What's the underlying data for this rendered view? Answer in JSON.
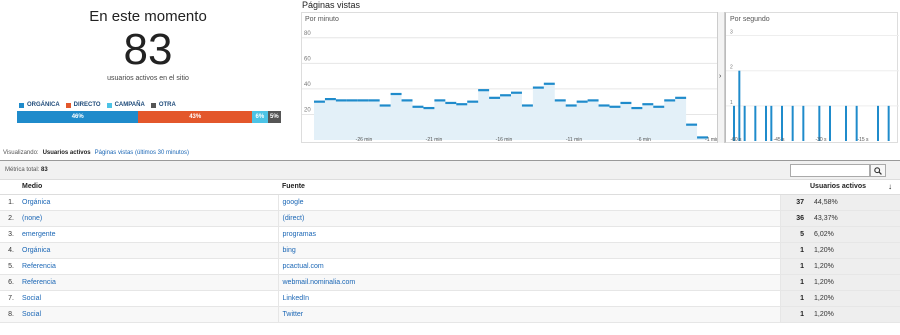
{
  "realtime": {
    "title": "En este momento",
    "count": "83",
    "caption": "usuarios activos en el sitio"
  },
  "traffic_legend": [
    {
      "label": "ORGÁNICA",
      "color": "#1f8bcb"
    },
    {
      "label": "DIRECTO",
      "color": "#e3572b"
    },
    {
      "label": "CAMPAÑA",
      "color": "#4cc3e6"
    },
    {
      "label": "OTRA",
      "color": "#555555"
    }
  ],
  "traffic_split": [
    {
      "label": "46%",
      "value": 46,
      "color": "#1f8bcb"
    },
    {
      "label": "43%",
      "value": 43,
      "color": "#e3572b"
    },
    {
      "label": "6%",
      "value": 6,
      "color": "#4cc3e6"
    },
    {
      "label": "5%",
      "value": 5,
      "color": "#555555"
    }
  ],
  "pageviews": {
    "title": "Páginas vistas",
    "per_minute_label": "Por minuto",
    "per_second_label": "Por segundo",
    "split_arrow": "›"
  },
  "chart_data": [
    {
      "type": "bar",
      "title": "Por minuto",
      "yticks": [
        20,
        40,
        60,
        80
      ],
      "ylim": [
        0,
        90
      ],
      "xticks": [
        "-26 min",
        "-21 min",
        "-16 min",
        "-11 min",
        "-6 min",
        "-1 min"
      ],
      "values": [
        30,
        32,
        31,
        31,
        31,
        31,
        27,
        36,
        31,
        26,
        25,
        31,
        29,
        28,
        30,
        39,
        33,
        35,
        37,
        27,
        41,
        44,
        31,
        27,
        30,
        31,
        27,
        26,
        29,
        25,
        28,
        26,
        31,
        33,
        12,
        2
      ],
      "grid": true
    },
    {
      "type": "bar",
      "title": "Por segundo",
      "yticks": [
        1,
        2,
        3
      ],
      "ylim": [
        0,
        3.3
      ],
      "xticks": [
        "-60 s",
        "-45 s",
        "-30 s",
        "-15 s"
      ],
      "values": [
        1,
        2,
        1,
        0,
        1,
        0,
        1,
        1,
        0,
        1,
        0,
        1,
        0,
        1,
        0,
        0,
        1,
        0,
        1,
        0,
        0,
        1,
        0,
        1,
        0,
        0,
        0,
        1,
        0,
        1
      ],
      "grid": true
    }
  ],
  "viewing": {
    "label": "Visualizando:",
    "active": "Usuarios activos",
    "pages": "Páginas vistas (últimos 30 minutos)"
  },
  "metric": {
    "label": "Métrica total:",
    "value": "83"
  },
  "search": {
    "placeholder": ""
  },
  "table": {
    "columns": {
      "medio": "Medio",
      "fuente": "Fuente",
      "usuarios": "Usuarios activos",
      "sort": "↓"
    },
    "rows": [
      {
        "idx": "1.",
        "medio": "Orgánica",
        "fuente": "google",
        "val": "37",
        "pct": "44,58%"
      },
      {
        "idx": "2.",
        "medio": "(none)",
        "fuente": "(direct)",
        "val": "36",
        "pct": "43,37%"
      },
      {
        "idx": "3.",
        "medio": "emergente",
        "fuente": "programas",
        "val": "5",
        "pct": "6,02%"
      },
      {
        "idx": "4.",
        "medio": "Orgánica",
        "fuente": "bing",
        "val": "1",
        "pct": "1,20%"
      },
      {
        "idx": "5.",
        "medio": "Referencia",
        "fuente": "pcactual.com",
        "val": "1",
        "pct": "1,20%"
      },
      {
        "idx": "6.",
        "medio": "Referencia",
        "fuente": "webmail.nominalia.com",
        "val": "1",
        "pct": "1,20%"
      },
      {
        "idx": "7.",
        "medio": "Social",
        "fuente": "LinkedIn",
        "val": "1",
        "pct": "1,20%"
      },
      {
        "idx": "8.",
        "medio": "Social",
        "fuente": "Twitter",
        "val": "1",
        "pct": "1,20%"
      }
    ]
  }
}
